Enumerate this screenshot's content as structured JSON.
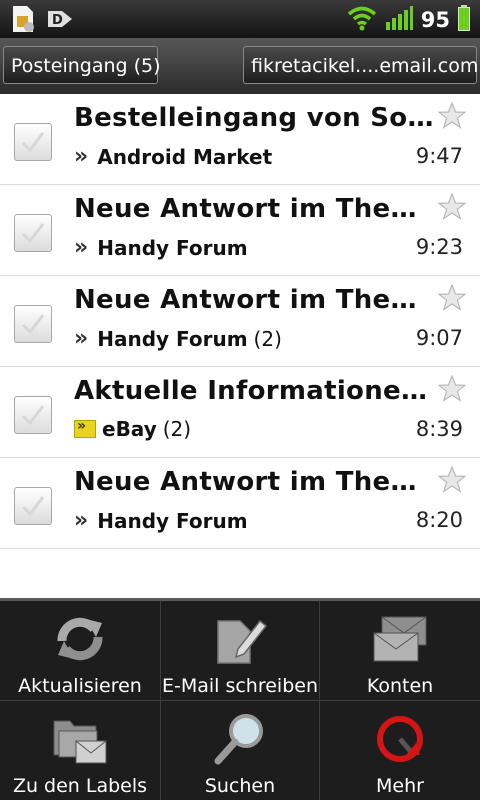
{
  "status_bar": {
    "battery_level": "95",
    "icons": [
      "sim-card-icon",
      "usb-debug-icon",
      "wifi-icon",
      "signal-icon",
      "battery-icon"
    ]
  },
  "header": {
    "inbox_label": "Posteingang (5)",
    "account": "fikretacikel....email.com"
  },
  "emails": [
    {
      "subject": "Bestelleingang von Sonny...",
      "sender": "Android Market",
      "count": "",
      "time": "9:47",
      "marker": "chevron"
    },
    {
      "subject": "Neue Antwort im Thema '...",
      "sender": "Handy Forum",
      "count": "",
      "time": "9:23",
      "marker": "chevron"
    },
    {
      "subject": "Neue Antwort im Thema '...",
      "sender": "Handy Forum",
      "count": "(2)",
      "time": "9:07",
      "marker": "chevron"
    },
    {
      "subject": "Aktuelle Informationen f...",
      "sender": "eBay",
      "count": "(2)",
      "time": "8:39",
      "marker": "important-tag"
    },
    {
      "subject": "Neue Antwort im Thema '...",
      "sender": "Handy Forum",
      "count": "",
      "time": "8:20",
      "marker": "chevron"
    }
  ],
  "menu": {
    "refresh": "Aktualisieren",
    "compose": "E-Mail schreiben",
    "accounts": "Konten",
    "labels": "Zu den Labels",
    "search": "Suchen",
    "more": "Mehr"
  },
  "colors": {
    "accent_green": "#6ccf1e",
    "important_tag": "#e8d320",
    "more_red": "#d41515"
  }
}
